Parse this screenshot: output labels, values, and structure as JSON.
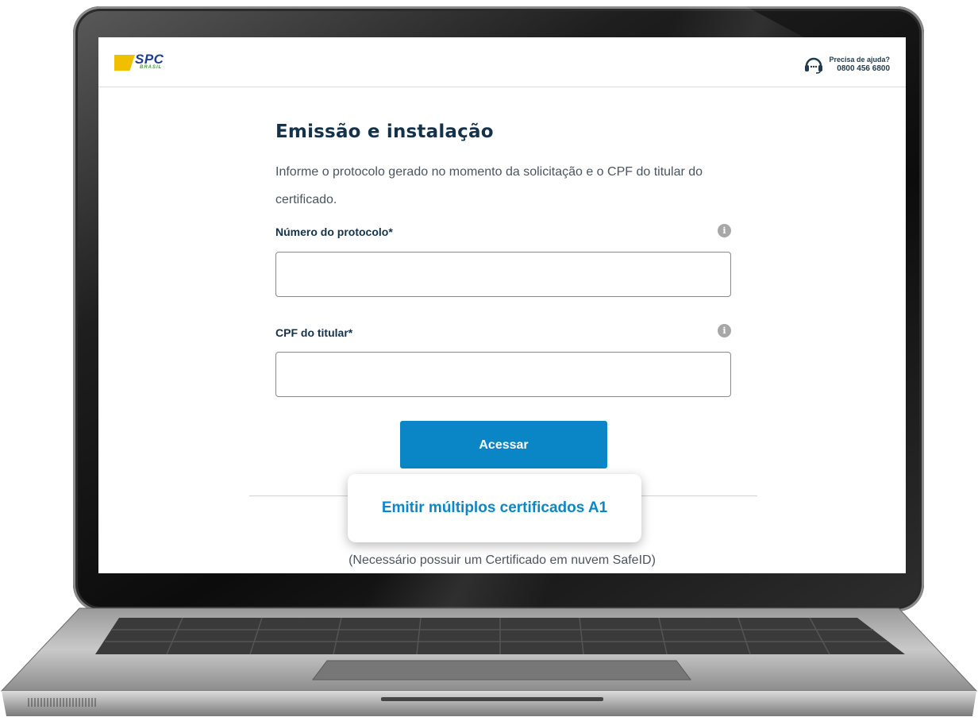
{
  "header": {
    "logo_text": "SPC",
    "logo_sub": "BRASIL",
    "help_title": "Precisa de ajuda?",
    "help_phone": "0800 456 6800"
  },
  "main": {
    "title": "Emissão e instalação",
    "description": "Informe o protocolo gerado no momento da solicitação e o CPF do titular do certificado.",
    "protocol_label": "Número do protocolo*",
    "protocol_value": "",
    "cpf_label": "CPF do titular*",
    "cpf_value": "",
    "submit_label": "Acessar",
    "multi_label": "Emitir múltiplos certificados A1",
    "note": "(Necessário possuir um Certificado em nuvem SafeID)"
  },
  "icons": {
    "help": "headset-icon",
    "info": "info-icon",
    "logo": "spc-logo"
  },
  "colors": {
    "primary": "#0a85c5",
    "heading": "#14324a",
    "body_text": "#4b5560",
    "logo_yellow": "#f0c000",
    "logo_blue": "#1f3c8f",
    "logo_green": "#4a9f3c"
  }
}
